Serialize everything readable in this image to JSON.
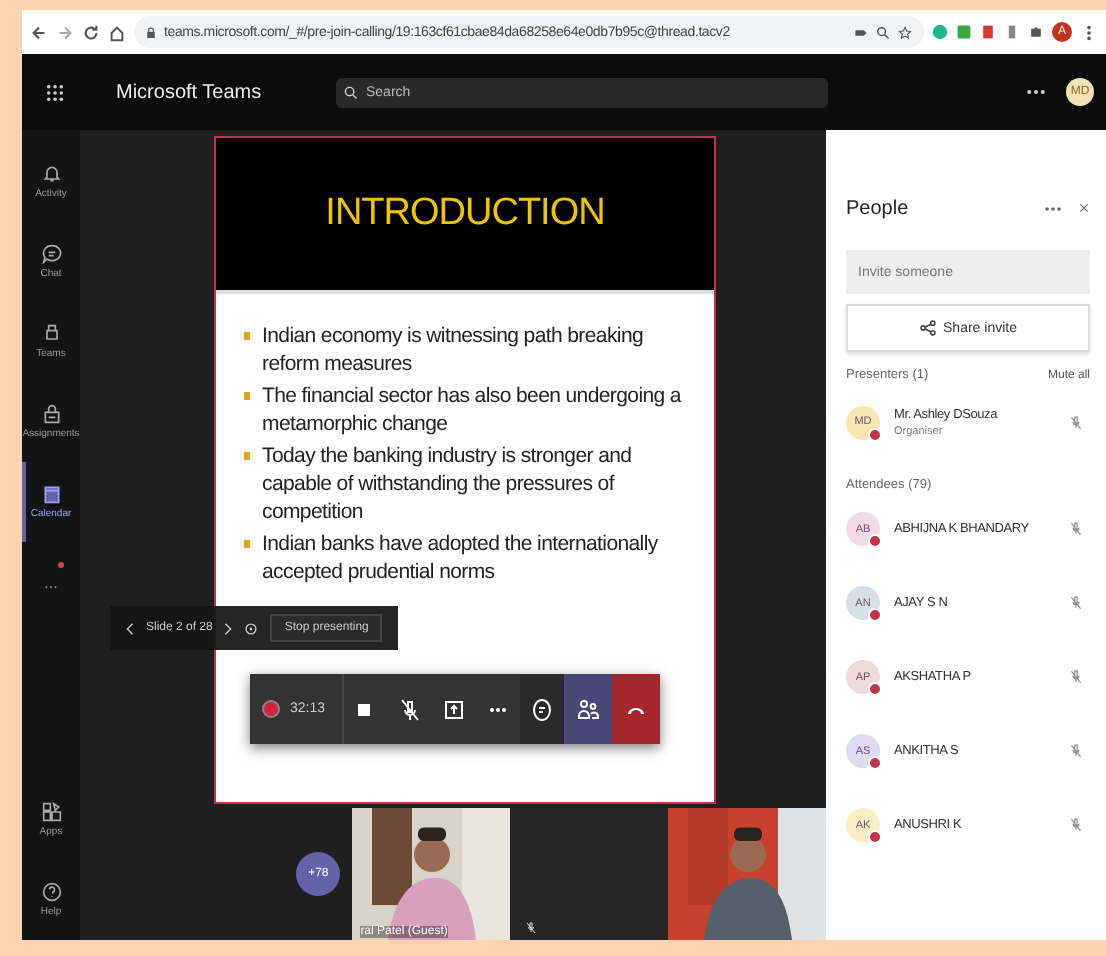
{
  "browser": {
    "url": "teams.microsoft.com/_#/pre-join-calling/19:163cf61cbae84da68258e64e0db7b95c@thread.tacv2",
    "profile_initial": "A"
  },
  "header": {
    "app_title": "Microsoft Teams",
    "search": {
      "placeholder": "Search"
    },
    "avatar": "MD"
  },
  "rail": [
    {
      "kind": "bell",
      "label": "Activity",
      "selected": false
    },
    {
      "kind": "chat",
      "label": "Chat",
      "selected": false
    },
    {
      "kind": "teams",
      "label": "Teams",
      "selected": false
    },
    {
      "kind": "bag",
      "label": "Assignments",
      "selected": false
    },
    {
      "kind": "calendar",
      "label": "Calendar",
      "selected": true
    },
    {
      "kind": "more",
      "label": "...",
      "notification": true,
      "selected": false
    },
    {
      "kind": "apps",
      "label": "Apps",
      "selected": false
    },
    {
      "kind": "help",
      "label": "Help",
      "selected": false
    }
  ],
  "slide": {
    "title": "INTRODUCTION",
    "bullets": [
      "Indian economy is witnessing path breaking reform measures",
      "The financial sector has also been undergoing a metamorphic change",
      "Today the banking industry is stronger and capable of withstanding the pressures of competition",
      "Indian banks have adopted the internationally accepted prudential norms"
    ]
  },
  "slide_nav": {
    "position": "Slide 2 of 28",
    "action": "Stop presenting"
  },
  "call_controls": {
    "recording": true,
    "timer": "32:13",
    "buttons": [
      {
        "kind": "camera"
      },
      {
        "kind": "mic-off"
      },
      {
        "kind": "share"
      },
      {
        "kind": "more"
      },
      {
        "kind": "chat"
      },
      {
        "kind": "people",
        "selected": true
      },
      {
        "kind": "hangup"
      }
    ]
  },
  "video_strip": {
    "overflow": "+78",
    "tiles": [
      {
        "kind": "video",
        "caption": "ral Patel (Guest)"
      },
      {
        "kind": "muted"
      },
      {
        "kind": "video"
      }
    ]
  },
  "people": {
    "title": "People",
    "invite": {
      "placeholder": "Invite someone"
    },
    "share_button": "Share invite",
    "sections": [
      {
        "label": "Presenters (1)",
        "action": "Mute all",
        "members": [
          {
            "initials": "MD",
            "name": "Mr. Ashley DSouza",
            "role": "Organiser",
            "color": "#f8e6b0"
          }
        ]
      },
      {
        "label": "Attendees (79)",
        "members": [
          {
            "initials": "AB",
            "name": "ABHIJNA K BHANDARY",
            "color": "#f1dbe6"
          },
          {
            "initials": "AN",
            "name": "AJAY S N",
            "color": "#d5e0e5"
          },
          {
            "initials": "AP",
            "name": "AKSHATHA P",
            "color": "#ecdbd6"
          },
          {
            "initials": "AS",
            "name": "ANKITHA S",
            "color": "#dfdbf0"
          },
          {
            "initials": "AK",
            "name": "ANUSHRI K",
            "color": "#fbeec4"
          }
        ]
      }
    ]
  }
}
